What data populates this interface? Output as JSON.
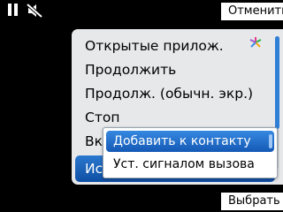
{
  "status_bar": {
    "icons": [
      "pause-icon",
      "mute-icon"
    ]
  },
  "softkeys": {
    "cancel": "Отменить",
    "select": "Выбрать"
  },
  "options_menu": {
    "items": [
      {
        "label": "Открытые прилож."
      },
      {
        "label": "Продолжить"
      },
      {
        "label": "Продолж. (обычн. экр.)"
      },
      {
        "label": "Стоп"
      },
      {
        "label": "Вк."
      },
      {
        "label": "Ис"
      }
    ],
    "selected_index": 5
  },
  "submenu": {
    "items": [
      {
        "label": "Добавить к контакту"
      },
      {
        "label": "Уст. сигналом вызова"
      }
    ],
    "selected_index": 0
  },
  "colors": {
    "selection": "#1f66c2",
    "menu_background": "#e7e8ea",
    "screen_background": "#000000"
  }
}
